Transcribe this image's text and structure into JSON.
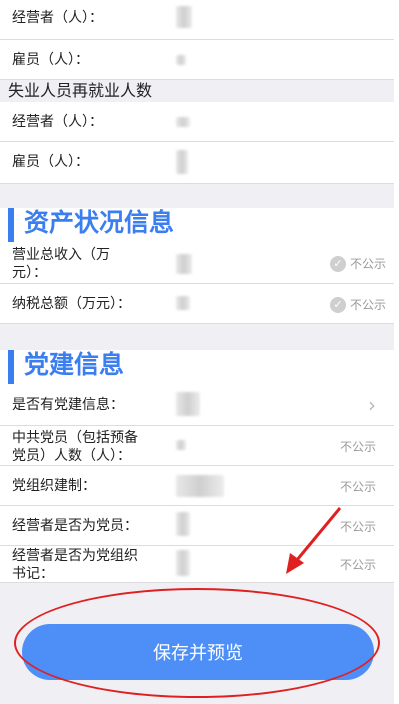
{
  "rows_top": [
    {
      "label": "经营者（人）："
    },
    {
      "label": "雇员（人）："
    }
  ],
  "reemployment_section": {
    "title": "失业人员再就业人数"
  },
  "rows_reemployment": [
    {
      "label": "经营者（人）："
    },
    {
      "label": "雇员（人）："
    }
  ],
  "assets_section": {
    "title": "资产状况信息"
  },
  "assets_rows": [
    {
      "label_line1": "营业总收入（万",
      "label_line2": "元）：",
      "public_text": "不公示"
    },
    {
      "label": "纳税总额（万元）：",
      "public_text": "不公示"
    }
  ],
  "party_section": {
    "title": "党建信息"
  },
  "party_rows": [
    {
      "label": "是否有党建信息："
    },
    {
      "label_line1": "中共党员（包括预备",
      "label_line2": "党员）人数（人）：",
      "public_text": "不公示"
    },
    {
      "label": "党组织建制：",
      "public_text": "不公示"
    },
    {
      "label": "经营者是否为党员：",
      "public_text": "不公示"
    },
    {
      "label_line1": "经营者是否为党组织",
      "label_line2": "书记：",
      "public_text": "不公示"
    }
  ],
  "save_button": {
    "label": "保存并预览"
  },
  "colors": {
    "accent": "#3b7ef0",
    "button": "#4d8ff7",
    "annotation": "#e02020"
  }
}
